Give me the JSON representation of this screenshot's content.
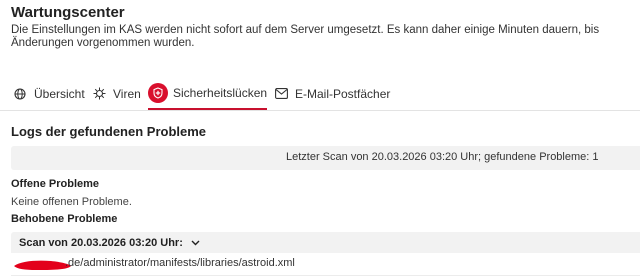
{
  "page": {
    "title": "Wartungscenter",
    "intro": "Die Einstellungen im KAS werden nicht sofort auf dem Server umgesetzt. Es kann daher einige Minuten dauern, bis Änderungen vorgenommen wurden."
  },
  "tabs": [
    {
      "label": "Übersicht",
      "icon": "globe-icon",
      "active": false
    },
    {
      "label": "Viren",
      "icon": "virus-icon",
      "active": false
    },
    {
      "label": "Sicherheitslücken",
      "icon": "shield-cross-icon",
      "active": true
    },
    {
      "label": "E-Mail-Postfächer",
      "icon": "mail-icon",
      "active": false
    }
  ],
  "logs": {
    "heading": "Logs der gefundenen Probleme",
    "summary": "Letzter Scan von 20.03.2026 03:20 Uhr; gefundene Probleme: 1",
    "open_heading": "Offene Probleme",
    "open_text": "Keine offenen Probleme.",
    "resolved_heading": "Behobene Probleme",
    "scan_label": "Scan von 20.03.2026 03:20 Uhr:",
    "path": ".de/administrator/manifests/libraries/astroid.xml"
  },
  "colors": {
    "accent": "#d90f2d",
    "panel_bg": "#f2f2f2",
    "redaction": "#e3001b"
  }
}
